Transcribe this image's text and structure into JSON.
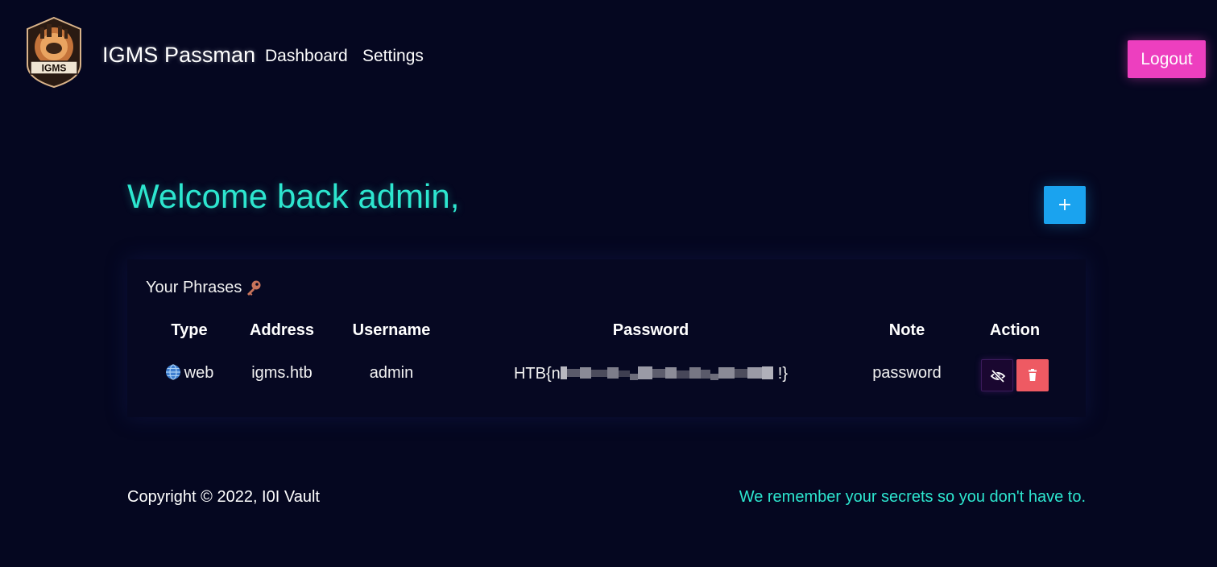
{
  "navbar": {
    "brand": "IGMS Passman",
    "logo_text": "IGMS",
    "links": [
      "Dashboard",
      "Settings"
    ],
    "logout_label": "Logout",
    "logout_color": "#ed3fbf"
  },
  "main": {
    "welcome": "Welcome back admin,",
    "add_label": "+",
    "accent_color": "#2de6cf"
  },
  "phrases": {
    "title": "Your Phrases",
    "title_icon": "key-icon",
    "columns": [
      "Type",
      "Address",
      "Username",
      "Password",
      "Note",
      "Action"
    ],
    "rows": [
      {
        "type_icon": "globe-icon",
        "type": "web",
        "address": "igms.htb",
        "username": "admin",
        "password_prefix": "HTB{n",
        "password_suffix": "!}",
        "note": "password",
        "actions": [
          "eye-slash-icon",
          "trash-icon"
        ]
      }
    ]
  },
  "footer": {
    "copyright": "Copyright © 2022, I0I Vault",
    "tagline": "We remember your secrets so you don't have to."
  }
}
